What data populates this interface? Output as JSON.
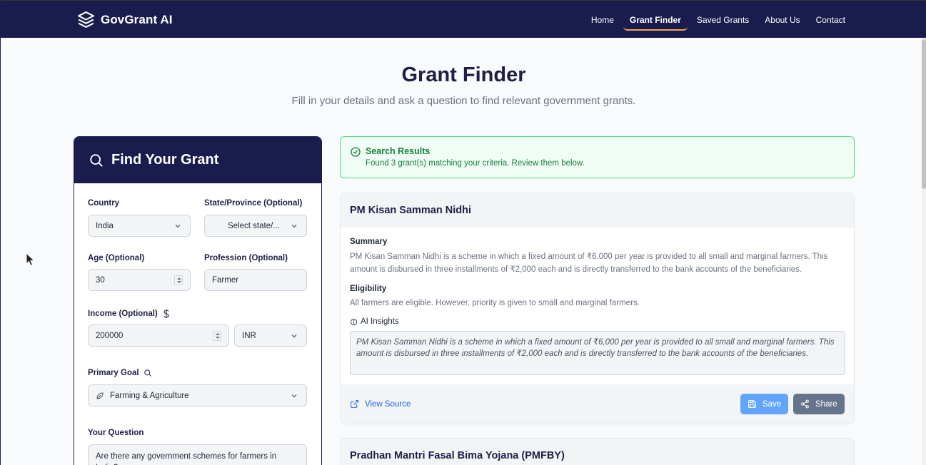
{
  "header": {
    "brand": "GovGrant AI",
    "nav": [
      "Home",
      "Grant Finder",
      "Saved Grants",
      "About Us",
      "Contact"
    ]
  },
  "hero": {
    "title": "Grant Finder",
    "subtitle": "Fill in your details and ask a question to find relevant government grants."
  },
  "form": {
    "title": "Find Your Grant",
    "country_label": "Country",
    "country_value": "India",
    "state_label": "State/Province (Optional)",
    "state_value": "Select state/...",
    "age_label": "Age (Optional)",
    "age_value": "30",
    "profession_label": "Profession (Optional)",
    "profession_value": "Farmer",
    "income_label": "Income (Optional)",
    "income_value": "200000",
    "currency_value": "INR",
    "goal_label": "Primary Goal",
    "goal_value": "Farming & Agriculture",
    "question_label": "Your Question",
    "question_value": "Are there any government schemes for farmers in India?"
  },
  "results": {
    "title": "Search Results",
    "message": "Found 3 grant(s) matching your criteria. Review them below."
  },
  "grants": [
    {
      "name": "PM Kisan Samman Nidhi",
      "summary_label": "Summary",
      "summary": "PM Kisan Samman Nidhi is a scheme in which a fixed amount of ₹6,000 per year is provided to all small and marginal farmers. This amount is disbursed in three installments of ₹2,000 each and is directly transferred to the bank accounts of the beneficiaries.",
      "eligibility_label": "Eligibility",
      "eligibility": "All farmers are eligible. However, priority is given to small and marginal farmers.",
      "insights_label": "AI Insights",
      "insights": "PM Kisan Samman Nidhi is a scheme in which a fixed amount of ₹6,000 per year is provided to all small and marginal farmers. This amount is disbursed in three installments of ₹2,000 each and is directly transferred to the bank accounts of the beneficiaries.",
      "view_source": "View Source",
      "save": "Save",
      "share": "Share"
    },
    {
      "name": "Pradhan Mantri Fasal Bima Yojana (PMFBY)"
    }
  ],
  "colors": {
    "navy": "#1b1c4e",
    "accent": "#f5a35b",
    "success": "#15803d",
    "link": "#2563eb"
  }
}
